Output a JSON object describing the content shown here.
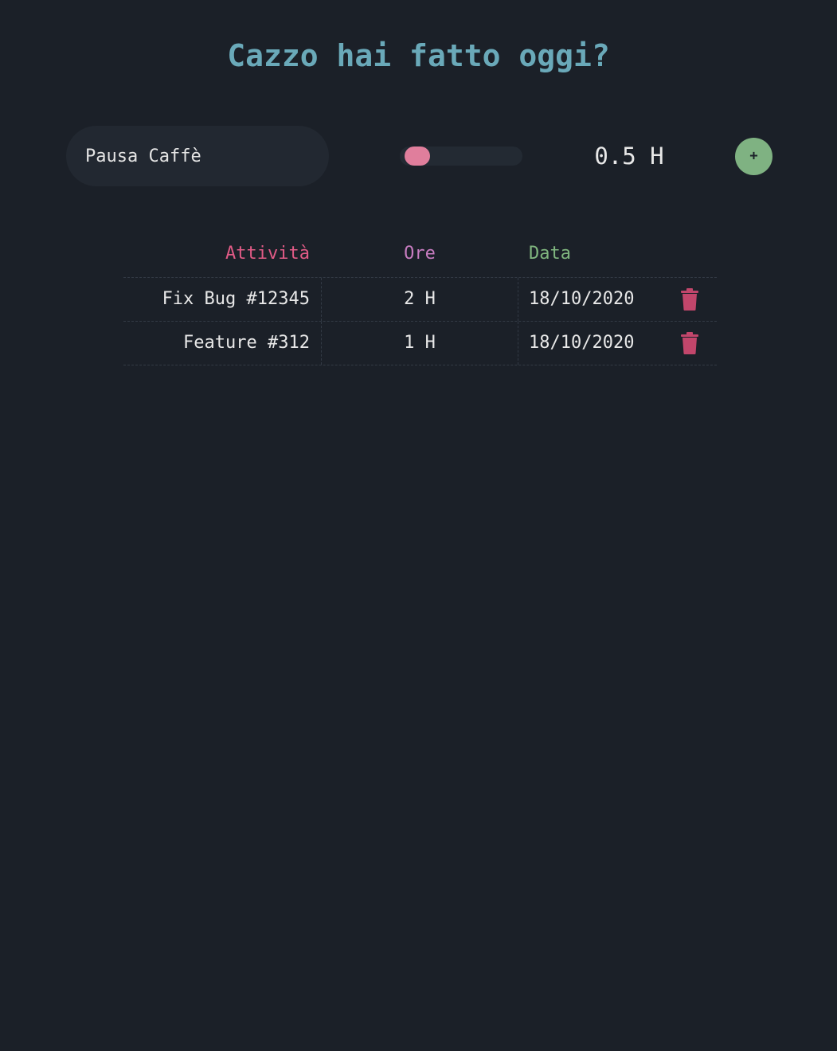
{
  "app": {
    "title": "Cazzo hai fatto oggi?"
  },
  "form": {
    "activity_value": "Pausa Caffè",
    "hours_slider_fraction": 0.05,
    "hours_display": "0.5 H",
    "add_label": "+"
  },
  "table": {
    "headers": {
      "activity": "Attività",
      "hours": "Ore",
      "date": "Data"
    },
    "rows": [
      {
        "activity": "Fix Bug #12345",
        "hours": "2 H",
        "date": "18/10/2020"
      },
      {
        "activity": "Feature #312",
        "hours": "1 H",
        "date": "18/10/2020"
      }
    ]
  },
  "colors": {
    "background": "#1b2028",
    "title": "#6aa9b9",
    "activity_header": "#e15b86",
    "hours_header": "#c77cc0",
    "date_header": "#80b67f",
    "slider_thumb": "#e07e9c",
    "add_button": "#7fb282",
    "delete_icon": "#c2466b"
  },
  "icons": {
    "delete": "trash-icon"
  }
}
